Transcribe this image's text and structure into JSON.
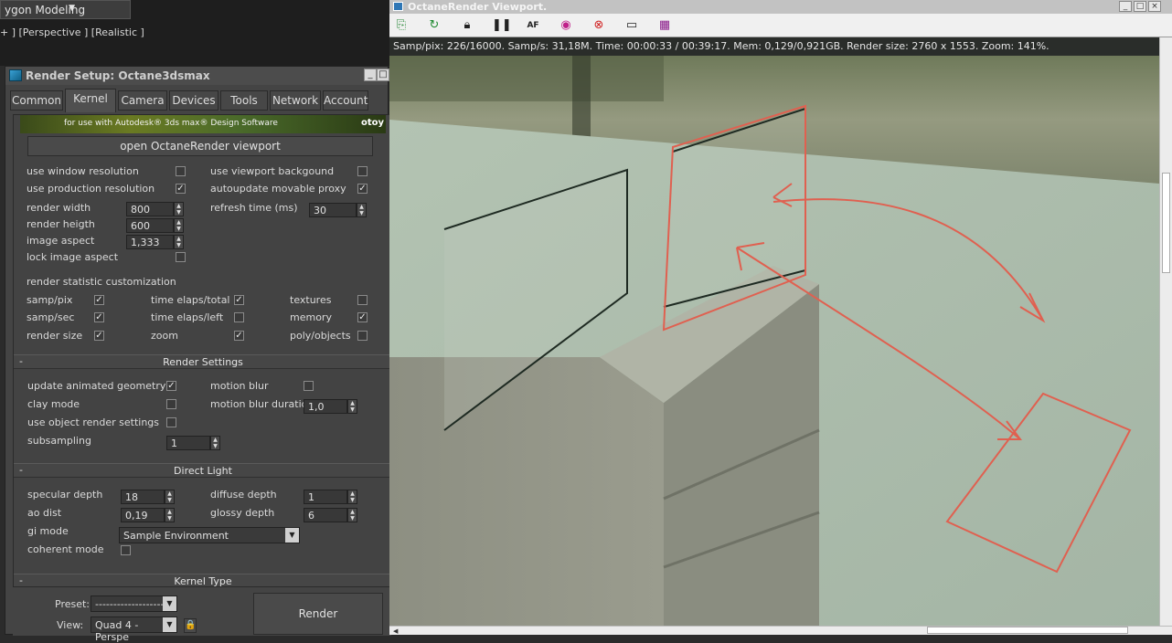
{
  "max": {
    "mode_label": "ygon Modeling",
    "viewport_label": "+ ] [Perspective ] [Realistic ]"
  },
  "render_setup": {
    "title": "Render Setup: Octane3dsmax",
    "tabs": [
      "Common",
      "Kernel",
      "Camera",
      "Devices",
      "Tools",
      "Network",
      "Account"
    ],
    "active_tab": "Kernel",
    "banner_text": "for use with Autodesk® 3ds max® Design Software",
    "banner_logo": "otoy",
    "open_viewport_label": "open OctaneRender viewport",
    "options": {
      "use_window_resolution": {
        "label": "use window resolution",
        "checked": false
      },
      "use_viewport_background": {
        "label": "use viewport backgound",
        "checked": false
      },
      "use_production_resolution": {
        "label": "use production resolution",
        "checked": true
      },
      "autoupdate_movable_proxy": {
        "label": "autoupdate movable proxy",
        "checked": true
      },
      "render_width": {
        "label": "render width",
        "value": "800"
      },
      "refresh_time": {
        "label": "refresh time (ms)",
        "value": "30"
      },
      "render_height": {
        "label": "render heigth",
        "value": "600"
      },
      "image_aspect": {
        "label": "image aspect",
        "value": "1,333"
      },
      "lock_image_aspect": {
        "label": "lock image aspect",
        "checked": false
      }
    },
    "stat_heading": "render statistic customization",
    "stats": [
      {
        "label": "samp/pix",
        "checked": true
      },
      {
        "label": "time elaps/total",
        "checked": true
      },
      {
        "label": "textures",
        "checked": false
      },
      {
        "label": "samp/sec",
        "checked": true
      },
      {
        "label": "time elaps/left",
        "checked": false
      },
      {
        "label": "memory",
        "checked": true
      },
      {
        "label": "render size",
        "checked": true
      },
      {
        "label": "zoom",
        "checked": true
      },
      {
        "label": "poly/objects",
        "checked": false
      }
    ],
    "render_settings": {
      "title": "Render Settings",
      "update_animated_geometry": {
        "label": "update animated geometry",
        "checked": true
      },
      "motion_blur": {
        "label": "motion blur",
        "checked": false
      },
      "clay_mode": {
        "label": "clay mode",
        "checked": false
      },
      "motion_blur_duration": {
        "label": "motion blur duration",
        "value": "1,0"
      },
      "use_object_render_settings": {
        "label": "use object render settings",
        "checked": false
      },
      "subsampling": {
        "label": "subsampling",
        "value": "1"
      }
    },
    "direct_light": {
      "title": "Direct Light",
      "specular_depth": {
        "label": "specular depth",
        "value": "18"
      },
      "diffuse_depth": {
        "label": "diffuse depth",
        "value": "1"
      },
      "ao_dist": {
        "label": "ao dist",
        "value": "0,19"
      },
      "glossy_depth": {
        "label": "glossy depth",
        "value": "6"
      },
      "gi_mode": {
        "label": "gi mode",
        "value": "Sample Environment"
      },
      "coherent_mode": {
        "label": "coherent mode",
        "checked": false
      }
    },
    "kernel_type_title": "Kernel Type",
    "footer": {
      "preset_label": "Preset:",
      "preset_value": "-------------------",
      "view_label": "View:",
      "view_value": "Quad 4 - Perspe",
      "render_label": "Render"
    }
  },
  "octane_viewport": {
    "title": "OctaneRender Viewport.",
    "toolbar_icons": [
      "save-icon",
      "refresh-icon",
      "lock-icon",
      "pause-icon",
      "autofocus-icon",
      "color-picker-icon",
      "stop-icon",
      "monitor-icon",
      "film-icon"
    ],
    "stats_line": "Samp/pix: 226/16000.   Samp/s: 31,18M.   Time: 00:00:33 / 00:39:17.   Mem: 0,129/0,921GB.   Render size: 2760 x 1553.   Zoom: 141%."
  },
  "colors": {
    "panel_bg": "#434343",
    "viewport_floor": "#a8b8a8",
    "annotation_stroke": "#e06050"
  }
}
